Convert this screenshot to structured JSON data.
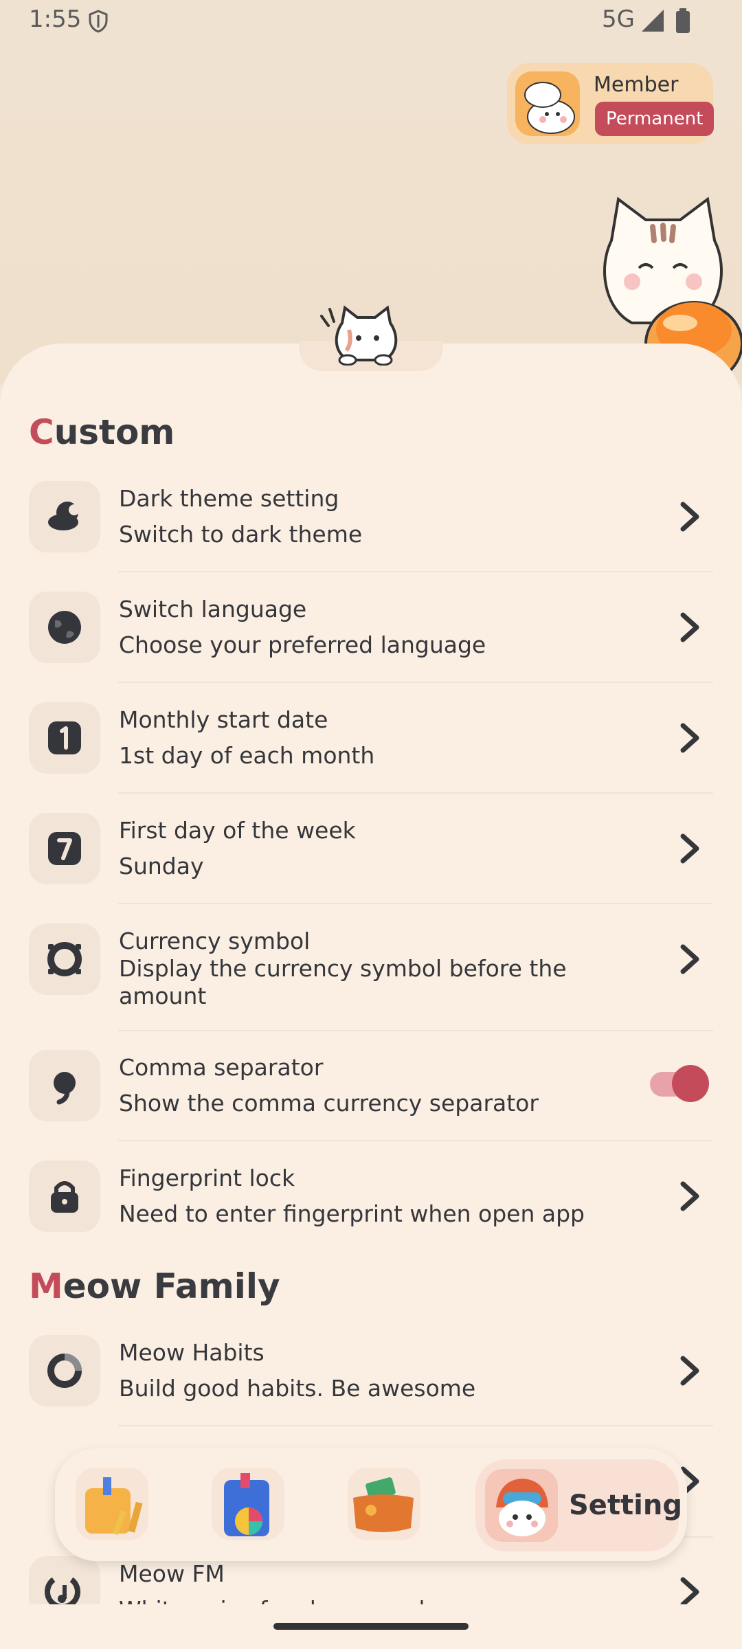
{
  "status_bar": {
    "time": "1:55",
    "network": "5G"
  },
  "member": {
    "title": "Member",
    "pill": "Permanent"
  },
  "sections": {
    "custom": {
      "first": "C",
      "rest": "ustom"
    },
    "family": {
      "first": "M",
      "rest": "eow Family"
    }
  },
  "rows": [
    {
      "title": "Dark theme setting",
      "subtitle": "Switch to dark theme",
      "icon": "moon-cloud-icon"
    },
    {
      "title": "Switch language",
      "subtitle": "Choose your preferred language",
      "icon": "globe-icon"
    },
    {
      "title": "Monthly start date",
      "subtitle": "1st day of each month",
      "icon": "calendar-one-icon"
    },
    {
      "title": "First day of the week",
      "subtitle": "Sunday",
      "icon": "calendar-seven-icon"
    },
    {
      "title": "Currency symbol",
      "subtitle": "Display the currency symbol before the amount",
      "icon": "ring-icon"
    },
    {
      "title": "Comma separator",
      "subtitle": "Show the comma currency separator",
      "icon": "comma-icon",
      "toggle_on": true
    },
    {
      "title": "Fingerprint lock",
      "subtitle": "Need to enter fingerprint when open app",
      "icon": "lock-icon"
    }
  ],
  "family_rows": [
    {
      "title": "Meow Habits",
      "subtitle": "Build good habits. Be awesome",
      "icon": "habit-circle-icon"
    },
    {
      "title": "Meow FM",
      "subtitle": "White noise for sleep or relax",
      "icon": "music-note-icon"
    }
  ],
  "bottom_nav": {
    "active_label": "Setting",
    "items": [
      "notebook-icon",
      "chart-book-icon",
      "wallet-icon",
      "cat-pilot-icon"
    ]
  },
  "colors": {
    "accent": "#c44c5a",
    "background": "#faefe2"
  }
}
